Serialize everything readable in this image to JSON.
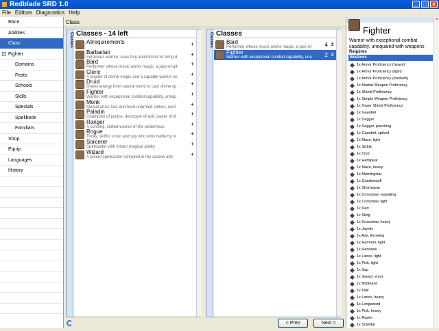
{
  "app": {
    "title": "Redblade SRD 1.0"
  },
  "menu": [
    "File",
    "Editors",
    "Diagnostics",
    "Help"
  ],
  "sidebar": [
    {
      "label": "Race",
      "sub": false
    },
    {
      "label": "Abilities",
      "sub": false
    },
    {
      "label": "Class",
      "sub": false,
      "selected": true
    },
    {
      "label": "Fighter",
      "sub": false,
      "tree": true
    },
    {
      "label": "Domains",
      "sub": true
    },
    {
      "label": "Feats",
      "sub": true
    },
    {
      "label": "Schools",
      "sub": true
    },
    {
      "label": "Skills",
      "sub": true
    },
    {
      "label": "Specials",
      "sub": true
    },
    {
      "label": "Spellbook",
      "sub": true
    },
    {
      "label": "Familiars",
      "sub": true
    },
    {
      "label": "Shop",
      "sub": false
    },
    {
      "label": "Equip",
      "sub": false
    },
    {
      "label": "Languages",
      "sub": false
    },
    {
      "label": "History",
      "sub": false
    }
  ],
  "main": {
    "breadcrumb": "Class",
    "left_panel": {
      "tab": "Classes",
      "title": "Classes - 14 left",
      "items": [
        {
          "name": "Allrequirements",
          "desc": ""
        },
        {
          "name": "Barbarian",
          "desc": "Ferocious warrior, uses fury and instinct to bring d"
        },
        {
          "name": "Bard",
          "desc": "Performer whose music works magic, a jack-of-all-"
        },
        {
          "name": "Cleric",
          "desc": "A master of divine magic and a capable warrior as"
        },
        {
          "name": "Druid",
          "desc": "Draws energy from natural world to cast divine sp"
        },
        {
          "name": "Fighter",
          "desc": "Warrior with exceptional combat capability, unequ"
        },
        {
          "name": "Monk",
          "desc": "Martial artist, fast and hard unarmed strikes, exot"
        },
        {
          "name": "Paladin",
          "desc": "Champion of justice, destroyer of evil, caster of di"
        },
        {
          "name": "Ranger",
          "desc": "A cunning, skilled warrior of the wilderness."
        },
        {
          "name": "Rogue",
          "desc": "Tricky, skillful scout and spy who wins battle by st"
        },
        {
          "name": "Sorcerer",
          "desc": "Spellcaster with inborn magical ability"
        },
        {
          "name": "Wizard",
          "desc": "A potent spellcaster schooled in the arcane arts"
        }
      ]
    },
    "right_panel": {
      "tab": "Classes",
      "title": "Classes",
      "items": [
        {
          "name": "Bard",
          "desc": "Performer whose music works magic, a jack-of-",
          "count": "4"
        },
        {
          "name": "Fighter",
          "desc": "Warrior with exceptional combat capability, une",
          "count": "2",
          "selected": true
        }
      ]
    },
    "prev_label": "< Prev",
    "next_label": "Next >"
  },
  "detail": {
    "title": "Fighter",
    "description": "Warrior with exceptional combat capability, unequaled with weapons",
    "requires_label": "Requires",
    "bestows_label": "Bestows",
    "bestows": [
      "1x Armor Proficiency (heavy)",
      "1x Armor Proficiency (light)",
      "1x Armor Proficiency (medium)",
      "1x Martial Weapon Proficiency",
      "1x Shield Proficiency",
      "1x Simple Weapon Proficiency",
      "1x Tower Shield Proficiency",
      "1x Gauntlet",
      "1x Dagger",
      "1x Dagger, punching",
      "1x Gauntlet, spiked",
      "1x Mace, light",
      "1x Sickle",
      "1x Club",
      "1x Halfspear",
      "1x Mace, heavy",
      "1x Morningstar",
      "1x Quarterstaff",
      "1x Shortspear",
      "1x Crossbow, repeating",
      "1x Crossbow, light",
      "1x Dart",
      "1x Sling",
      "1x Crossbow, heavy",
      "1x Javelin",
      "1x Axe, throwing",
      "1x Hammer, light",
      "1x Handaxe",
      "1x Lance, light",
      "1x Pick, light",
      "1x Sap",
      "1x Sword, short",
      "1x Battleaxe",
      "1x Flail",
      "1x Lance, heavy",
      "1x Longsword",
      "1x Pick, heavy",
      "1x Rapier",
      "1x Scimitar"
    ]
  }
}
